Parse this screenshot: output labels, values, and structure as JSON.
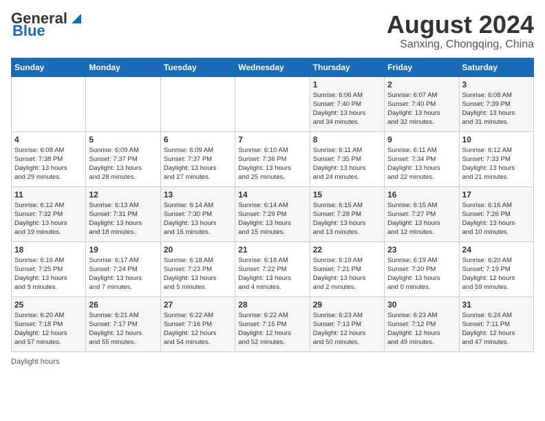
{
  "header": {
    "logo_general": "General",
    "logo_blue": "Blue",
    "month_year": "August 2024",
    "location": "Sanxing, Chongqing, China"
  },
  "days_of_week": [
    "Sunday",
    "Monday",
    "Tuesday",
    "Wednesday",
    "Thursday",
    "Friday",
    "Saturday"
  ],
  "footer": {
    "label": "Daylight hours"
  },
  "weeks": [
    [
      {
        "day": "",
        "info": ""
      },
      {
        "day": "",
        "info": ""
      },
      {
        "day": "",
        "info": ""
      },
      {
        "day": "",
        "info": ""
      },
      {
        "day": "1",
        "info": "Sunrise: 6:06 AM\nSunset: 7:40 PM\nDaylight: 13 hours\nand 34 minutes."
      },
      {
        "day": "2",
        "info": "Sunrise: 6:07 AM\nSunset: 7:40 PM\nDaylight: 13 hours\nand 32 minutes."
      },
      {
        "day": "3",
        "info": "Sunrise: 6:08 AM\nSunset: 7:39 PM\nDaylight: 13 hours\nand 31 minutes."
      }
    ],
    [
      {
        "day": "4",
        "info": "Sunrise: 6:08 AM\nSunset: 7:38 PM\nDaylight: 13 hours\nand 29 minutes."
      },
      {
        "day": "5",
        "info": "Sunrise: 6:09 AM\nSunset: 7:37 PM\nDaylight: 13 hours\nand 28 minutes."
      },
      {
        "day": "6",
        "info": "Sunrise: 6:09 AM\nSunset: 7:37 PM\nDaylight: 13 hours\nand 27 minutes."
      },
      {
        "day": "7",
        "info": "Sunrise: 6:10 AM\nSunset: 7:36 PM\nDaylight: 13 hours\nand 25 minutes."
      },
      {
        "day": "8",
        "info": "Sunrise: 6:11 AM\nSunset: 7:35 PM\nDaylight: 13 hours\nand 24 minutes."
      },
      {
        "day": "9",
        "info": "Sunrise: 6:11 AM\nSunset: 7:34 PM\nDaylight: 13 hours\nand 22 minutes."
      },
      {
        "day": "10",
        "info": "Sunrise: 6:12 AM\nSunset: 7:33 PM\nDaylight: 13 hours\nand 21 minutes."
      }
    ],
    [
      {
        "day": "11",
        "info": "Sunrise: 6:12 AM\nSunset: 7:32 PM\nDaylight: 13 hours\nand 19 minutes."
      },
      {
        "day": "12",
        "info": "Sunrise: 6:13 AM\nSunset: 7:31 PM\nDaylight: 13 hours\nand 18 minutes."
      },
      {
        "day": "13",
        "info": "Sunrise: 6:14 AM\nSunset: 7:30 PM\nDaylight: 13 hours\nand 16 minutes."
      },
      {
        "day": "14",
        "info": "Sunrise: 6:14 AM\nSunset: 7:29 PM\nDaylight: 13 hours\nand 15 minutes."
      },
      {
        "day": "15",
        "info": "Sunrise: 6:15 AM\nSunset: 7:28 PM\nDaylight: 13 hours\nand 13 minutes."
      },
      {
        "day": "16",
        "info": "Sunrise: 6:15 AM\nSunset: 7:27 PM\nDaylight: 13 hours\nand 12 minutes."
      },
      {
        "day": "17",
        "info": "Sunrise: 6:16 AM\nSunset: 7:26 PM\nDaylight: 13 hours\nand 10 minutes."
      }
    ],
    [
      {
        "day": "18",
        "info": "Sunrise: 6:16 AM\nSunset: 7:25 PM\nDaylight: 13 hours\nand 9 minutes."
      },
      {
        "day": "19",
        "info": "Sunrise: 6:17 AM\nSunset: 7:24 PM\nDaylight: 13 hours\nand 7 minutes."
      },
      {
        "day": "20",
        "info": "Sunrise: 6:18 AM\nSunset: 7:23 PM\nDaylight: 13 hours\nand 5 minutes."
      },
      {
        "day": "21",
        "info": "Sunrise: 6:18 AM\nSunset: 7:22 PM\nDaylight: 13 hours\nand 4 minutes."
      },
      {
        "day": "22",
        "info": "Sunrise: 6:19 AM\nSunset: 7:21 PM\nDaylight: 13 hours\nand 2 minutes."
      },
      {
        "day": "23",
        "info": "Sunrise: 6:19 AM\nSunset: 7:20 PM\nDaylight: 13 hours\nand 0 minutes."
      },
      {
        "day": "24",
        "info": "Sunrise: 6:20 AM\nSunset: 7:19 PM\nDaylight: 12 hours\nand 59 minutes."
      }
    ],
    [
      {
        "day": "25",
        "info": "Sunrise: 6:20 AM\nSunset: 7:18 PM\nDaylight: 12 hours\nand 57 minutes."
      },
      {
        "day": "26",
        "info": "Sunrise: 6:21 AM\nSunset: 7:17 PM\nDaylight: 12 hours\nand 55 minutes."
      },
      {
        "day": "27",
        "info": "Sunrise: 6:22 AM\nSunset: 7:16 PM\nDaylight: 12 hours\nand 54 minutes."
      },
      {
        "day": "28",
        "info": "Sunrise: 6:22 AM\nSunset: 7:15 PM\nDaylight: 12 hours\nand 52 minutes."
      },
      {
        "day": "29",
        "info": "Sunrise: 6:23 AM\nSunset: 7:13 PM\nDaylight: 12 hours\nand 50 minutes."
      },
      {
        "day": "30",
        "info": "Sunrise: 6:23 AM\nSunset: 7:12 PM\nDaylight: 12 hours\nand 49 minutes."
      },
      {
        "day": "31",
        "info": "Sunrise: 6:24 AM\nSunset: 7:11 PM\nDaylight: 12 hours\nand 47 minutes."
      }
    ]
  ]
}
